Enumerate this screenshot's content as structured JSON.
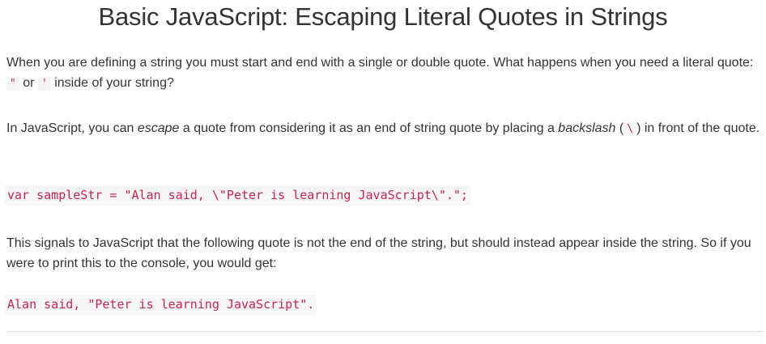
{
  "title": "Basic JavaScript: Escaping Literal Quotes in Strings",
  "p1": {
    "text_a": "When you are defining a string you must start and end with a single or double quote. What happens when you need a literal quote: ",
    "code_double": "\"",
    "text_b": " or ",
    "code_single": "'",
    "text_c": " inside of your string?"
  },
  "p2": {
    "text_a": "In JavaScript, you can ",
    "em_escape": "escape",
    "text_b": " a quote from considering it as an end of string quote by placing a ",
    "em_backslash": "backslash",
    "text_c": " (",
    "code_backslash": "\\",
    "text_d": ") in front of the quote."
  },
  "code_example": "var sampleStr = \"Alan said, \\\"Peter is learning JavaScript\\\".\";",
  "p3": {
    "text": "This signals to JavaScript that the following quote is not the end of the string, but should instead appear inside the string. So if you were to print this to the console, you would get:"
  },
  "output_example": "Alan said, \"Peter is learning JavaScript\"."
}
